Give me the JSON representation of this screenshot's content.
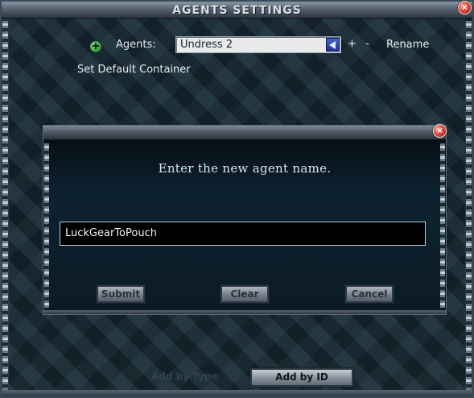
{
  "window": {
    "title": "AGENTS SETTINGS",
    "close_icon": "×"
  },
  "agents": {
    "icon": "✚",
    "label": "Agents:",
    "selected": "Undress 2",
    "plus": "+",
    "minus": "-",
    "rename": "Rename"
  },
  "set_default_container": "Set Default Container",
  "footer": {
    "add_by_id": "Add by ID",
    "add_by_type_partial": "Add by Type"
  },
  "dialog": {
    "close_icon": "×",
    "prompt": "Enter the new agent name.",
    "input_value": "LuckGearToPouch",
    "buttons": {
      "submit": "Submit",
      "clear": "Clear",
      "cancel": "Cancel"
    }
  },
  "colors": {
    "title_bar": "#56616d",
    "close_button": "#e0483a",
    "dropdown_arrow": "#1e3394",
    "background": "#14232d"
  }
}
